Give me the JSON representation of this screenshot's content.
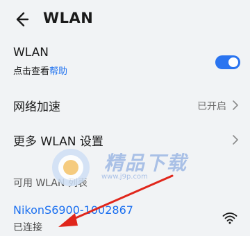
{
  "header": {
    "title": "WLAN"
  },
  "wlan_row": {
    "title": "WLAN",
    "subtitle_prefix": "点击查看",
    "subtitle_link": "帮助",
    "toggle_on": true
  },
  "network_accel_row": {
    "title": "网络加速",
    "value": "已开启"
  },
  "more_settings_row": {
    "title": "更多 WLAN 设置"
  },
  "available_section": {
    "header": "可用 WLAN 列表"
  },
  "connected_network": {
    "name": "NikonS6900-1002867",
    "status": "已连接"
  },
  "watermark": {
    "text": "精品下载",
    "url": "www.j9p.com"
  },
  "colors": {
    "accent": "#1a6ff0",
    "annotation": "#e0261b"
  }
}
